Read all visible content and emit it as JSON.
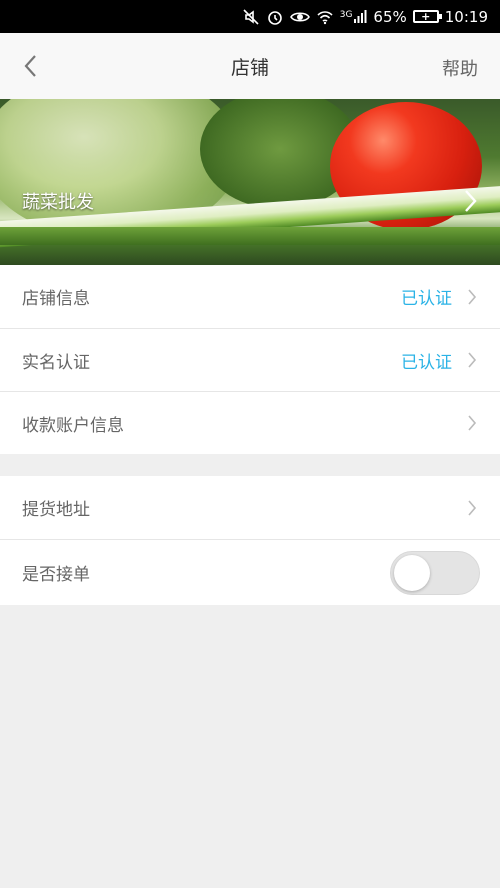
{
  "status_bar": {
    "battery": "65%",
    "signal": "3G",
    "time": "10:19"
  },
  "header": {
    "title": "店铺",
    "help_label": "帮助"
  },
  "banner": {
    "shop_name": "蔬菜批发"
  },
  "rows": {
    "shop_info": {
      "label": "店铺信息",
      "status": "已认证"
    },
    "real_name": {
      "label": "实名认证",
      "status": "已认证"
    },
    "payee": {
      "label": "收款账户信息"
    },
    "pickup": {
      "label": "提货地址"
    },
    "accept_orders": {
      "label": "是否接单",
      "enabled": false
    }
  },
  "colors": {
    "accent": "#2bb3e6",
    "background": "#efefef"
  }
}
